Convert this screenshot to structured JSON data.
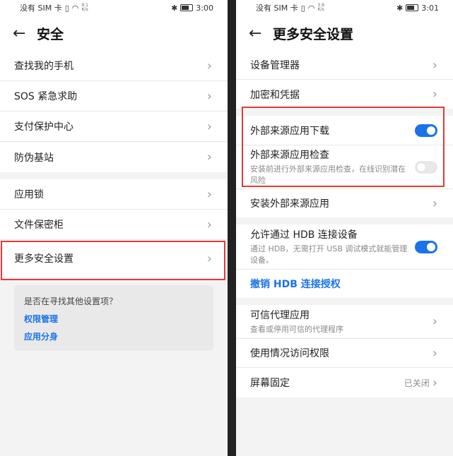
{
  "left": {
    "status": {
      "carrier": "没有 SIM 卡",
      "speed_top": "9.1",
      "speed_unit": "K/s",
      "time": "3:00"
    },
    "title": "安全",
    "group1": [
      "查找我的手机",
      "SOS 紧急求助",
      "支付保护中心",
      "防伪基站"
    ],
    "group2": [
      "应用锁",
      "文件保密柜",
      "更多安全设置"
    ],
    "card": {
      "question": "是否在寻找其他设置项？",
      "links": [
        "权限管理",
        "应用分身"
      ]
    }
  },
  "right": {
    "status": {
      "carrier": "没有 SIM 卡",
      "speed_top": "3.9",
      "speed_unit": "K/s",
      "time": "3:01"
    },
    "title": "更多安全设置",
    "group1": [
      "设备管理器",
      "加密和凭据"
    ],
    "external_download": {
      "label": "外部来源应用下载",
      "state": "on"
    },
    "external_check": {
      "label": "外部来源应用检查",
      "desc": "安装前进行外部来源应用检查，在线识别潜在风险",
      "state": "off"
    },
    "install_external": "安装外部来源应用",
    "hdb": {
      "label": "允许通过 HDB 连接设备",
      "desc": "通过 HDB，无需打开 USB 调试模式就能管理设备。",
      "state": "on"
    },
    "revoke": "撤销 HDB 连接授权",
    "trusted": {
      "label": "可信代理应用",
      "desc": "查看或停用可信的代理程序"
    },
    "usage": "使用情况访问权限",
    "pin": {
      "label": "屏幕固定",
      "value": "已关闭"
    }
  },
  "colors": {
    "accent": "#1a73e8",
    "highlight": "#e03a3a"
  }
}
